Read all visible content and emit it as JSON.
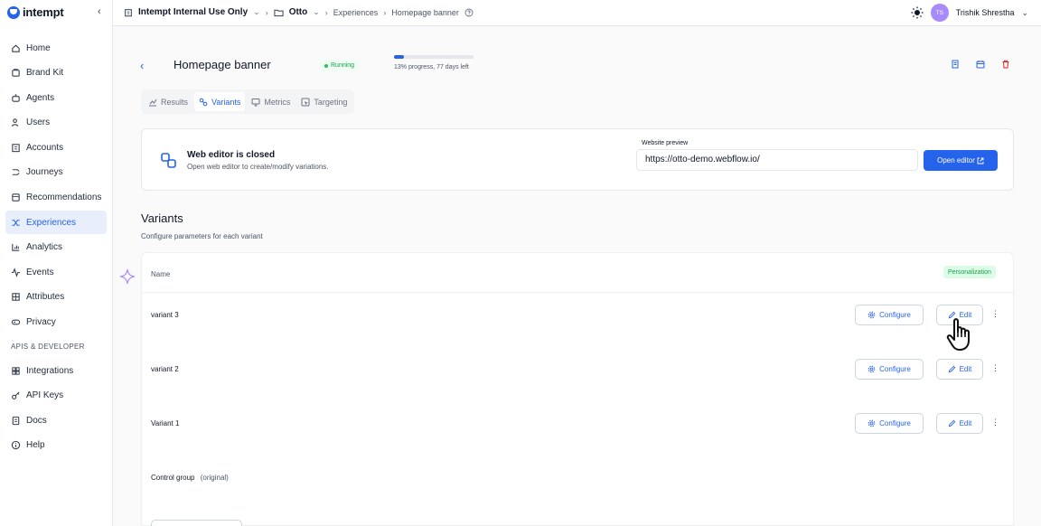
{
  "brand": {
    "name": "intempt",
    "accent": "#2563eb"
  },
  "sidebar": {
    "collapse_icon": "chevron-left-icon",
    "items": [
      {
        "label": "Home",
        "icon": "home-icon"
      },
      {
        "label": "Brand Kit",
        "icon": "brand-kit-icon"
      },
      {
        "label": "Agents",
        "icon": "agents-icon"
      },
      {
        "label": "Users",
        "icon": "users-icon"
      },
      {
        "label": "Accounts",
        "icon": "accounts-icon"
      },
      {
        "label": "Journeys",
        "icon": "journeys-icon"
      },
      {
        "label": "Recommendations",
        "icon": "recommendations-icon"
      },
      {
        "label": "Experiences",
        "icon": "experiences-icon",
        "active": true
      },
      {
        "label": "Analytics",
        "icon": "analytics-icon"
      },
      {
        "label": "Events",
        "icon": "events-icon"
      },
      {
        "label": "Attributes",
        "icon": "attributes-icon"
      },
      {
        "label": "Privacy",
        "icon": "privacy-icon"
      }
    ],
    "section_label": "APIS & DEVELOPER",
    "dev_items": [
      {
        "label": "Integrations",
        "icon": "integrations-icon"
      },
      {
        "label": "API Keys",
        "icon": "key-icon"
      },
      {
        "label": "Docs",
        "icon": "docs-icon"
      },
      {
        "label": "Help",
        "icon": "help-icon"
      }
    ]
  },
  "topbar": {
    "org": "Intempt Internal Use Only",
    "project": "Otto",
    "section": "Experiences",
    "page": "Homepage banner",
    "user_initials": "TS",
    "user_name": "Trishik Shrestha"
  },
  "experience": {
    "title": "Homepage banner",
    "status": "Running",
    "progress": 0.13,
    "progress_text": "13% progress, 77 days left"
  },
  "tabs": [
    "Results",
    "Variants",
    "Metrics",
    "Targeting"
  ],
  "active_tab": "Variants",
  "editor": {
    "title": "Web editor is closed",
    "subtitle": "Open web editor to create/modify variations.",
    "preview_label": "Website preview",
    "preview_url": "https://otto-demo.webflow.io/",
    "open_button": "Open editor"
  },
  "variants": {
    "title": "Variants",
    "subtitle": "Configure parameters for each variant",
    "column_name": "Name",
    "badge": "Personalization",
    "configure_label": "Configure",
    "edit_label": "Edit",
    "rows": [
      "variant 3",
      "variant 2",
      "Variant 1"
    ],
    "control_group": "Control group",
    "control_note": "(original)"
  }
}
